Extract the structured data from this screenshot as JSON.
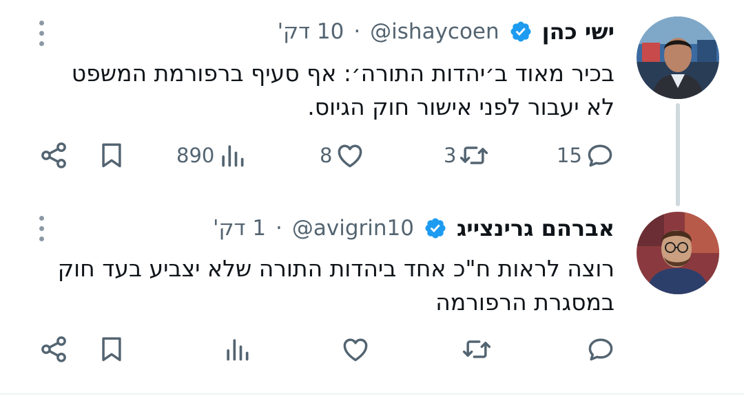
{
  "colors": {
    "text": "#0f1419",
    "secondary": "#536471",
    "verified": "#1d9bf0",
    "divider": "#cfd9de"
  },
  "tweets": [
    {
      "author_name": "ישי כהן",
      "handle": "@ishaycoen",
      "separator": "·",
      "time": "10 דק'",
      "text_lines": [
        "בכיר מאוד ב׳יהדות התורה׳: אף סעיף ברפורמת המשפט",
        "לא יעבור לפני אישור חוק הגיוס."
      ],
      "replies": "15",
      "retweets": "3",
      "likes": "8",
      "views": "890"
    },
    {
      "author_name": "אברהם גרינצייג",
      "handle": "@avigrin10",
      "separator": "·",
      "time": "1 דק'",
      "text_lines": [
        "רוצה לראות ח\"כ אחד ביהדות התורה שלא יצביע בעד חוק",
        "במסגרת הרפורמה"
      ],
      "replies": "",
      "retweets": "",
      "likes": "",
      "views": ""
    }
  ],
  "icons": [
    "verified-badge-icon",
    "more-vertical-icon",
    "reply-icon",
    "retweet-icon",
    "like-icon",
    "views-icon",
    "bookmark-icon",
    "share-icon"
  ]
}
